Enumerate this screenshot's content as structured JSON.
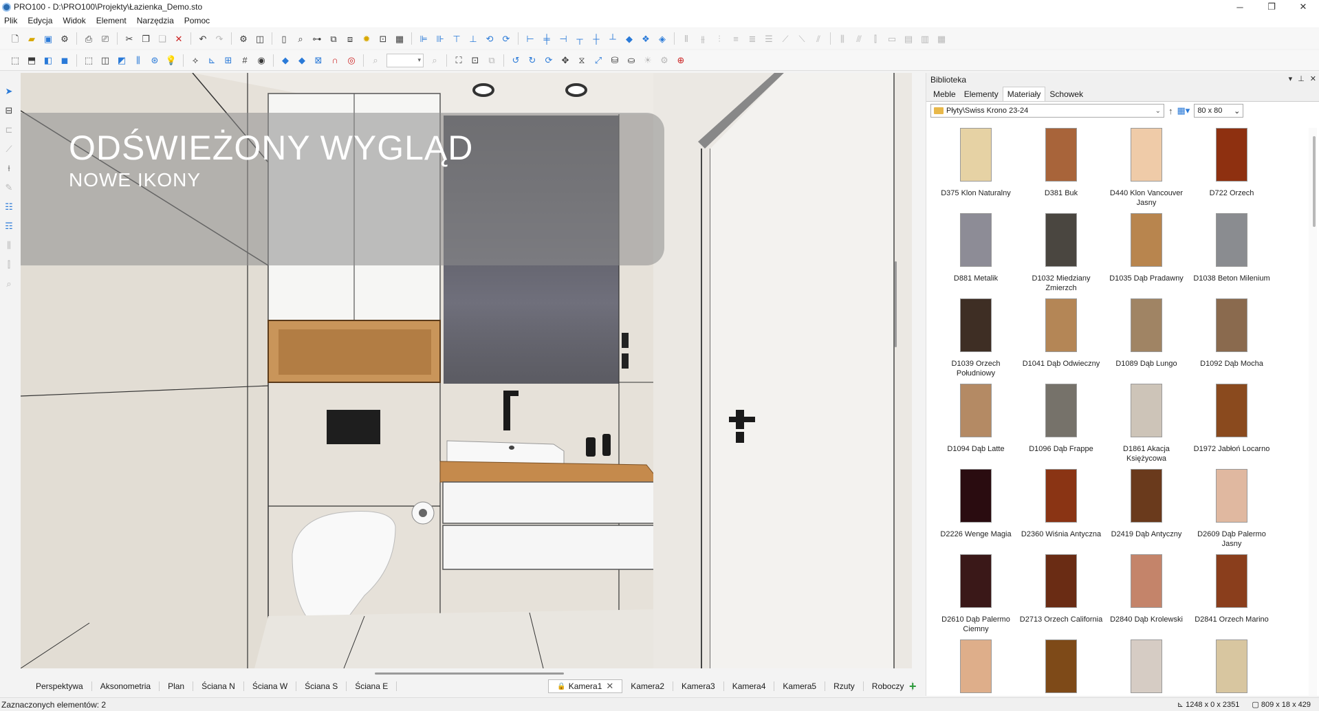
{
  "window": {
    "title": "PRO100 - D:\\PRO100\\Projekty\\Łazienka_Demo.sto",
    "controls": [
      "─",
      "❐",
      "✕"
    ]
  },
  "menu": [
    "Plik",
    "Edycja",
    "Widok",
    "Element",
    "Narzędzia",
    "Pomoc"
  ],
  "banner": {
    "title": "ODŚWIEŻONY WYGLĄD",
    "subtitle": "NOWE IKONY"
  },
  "view_tabs": [
    "Perspektywa",
    "Aksonometria",
    "Plan",
    "Ściana N",
    "Ściana W",
    "Ściana S",
    "Ściana E"
  ],
  "camera_tabs": {
    "active": "Kamera1",
    "others": [
      "Kamera2",
      "Kamera3",
      "Kamera4",
      "Kamera5",
      "Rzuty",
      "Roboczy"
    ]
  },
  "status": {
    "left": "Zaznaczonych elementów: 2",
    "dims1": "1248 x 0 x 2351",
    "dims2": "809 x 18 x 429"
  },
  "library": {
    "title": "Biblioteka",
    "tabs": [
      "Meble",
      "Elementy",
      "Materiały",
      "Schowek"
    ],
    "active_tab": "Materiały",
    "path": "Płyty\\Swiss Krono 23-24",
    "thumb_size": "80 x  80",
    "materials": [
      {
        "label": "D375 Klon Naturalny",
        "color": "#e6d2a4"
      },
      {
        "label": "D381 Buk",
        "color": "#a8643a"
      },
      {
        "label": "D440 Klon Vancouver Jasny",
        "color": "#efcba8"
      },
      {
        "label": "D722 Orzech",
        "color": "#8e3010"
      },
      {
        "label": "D881 Metalik",
        "color": "#8d8c96"
      },
      {
        "label": "D1032 Miedziany Zmierzch",
        "color": "#4a4640"
      },
      {
        "label": "D1035 Dąb Pradawny",
        "color": "#b8854e"
      },
      {
        "label": "D1038 Beton Milenium",
        "color": "#8a8c90"
      },
      {
        "label": "D1039 Orzech Południowy",
        "color": "#3e2e24"
      },
      {
        "label": "D1041 Dąb Odwieczny",
        "color": "#b48656"
      },
      {
        "label": "D1089 Dąb Lungo",
        "color": "#a08464"
      },
      {
        "label": "D1092 Dąb Mocha",
        "color": "#8a6a4e"
      },
      {
        "label": "D1094 Dąb Latte",
        "color": "#b48a64"
      },
      {
        "label": "D1096 Dąb Frappe",
        "color": "#76726a"
      },
      {
        "label": "D1861 Akacja Księżycowa",
        "color": "#cdc4b8"
      },
      {
        "label": "D1972 Jabłoń Locarno",
        "color": "#8a4a1e"
      },
      {
        "label": "D2226 Wenge Magia",
        "color": "#2a0c10"
      },
      {
        "label": "D2360 Wiśnia Antyczna",
        "color": "#8a3414"
      },
      {
        "label": "D2419 Dąb Antyczny",
        "color": "#6a3a1c"
      },
      {
        "label": "D2609 Dąb Palermo Jasny",
        "color": "#e0b8a0"
      },
      {
        "label": "D2610 Dąb Palermo Ciemny",
        "color": "#3a1818"
      },
      {
        "label": "D2713 Orzech California",
        "color": "#6a2c14"
      },
      {
        "label": "D2840 Dąb Krolewski",
        "color": "#c4846a"
      },
      {
        "label": "D2841 Orzech Marino",
        "color": "#8a3e1c"
      },
      {
        "label": "",
        "color": "#deae8a"
      },
      {
        "label": "",
        "color": "#7e4a18"
      },
      {
        "label": "",
        "color": "#d6ccc4"
      },
      {
        "label": "",
        "color": "#d8c6a0"
      }
    ]
  }
}
